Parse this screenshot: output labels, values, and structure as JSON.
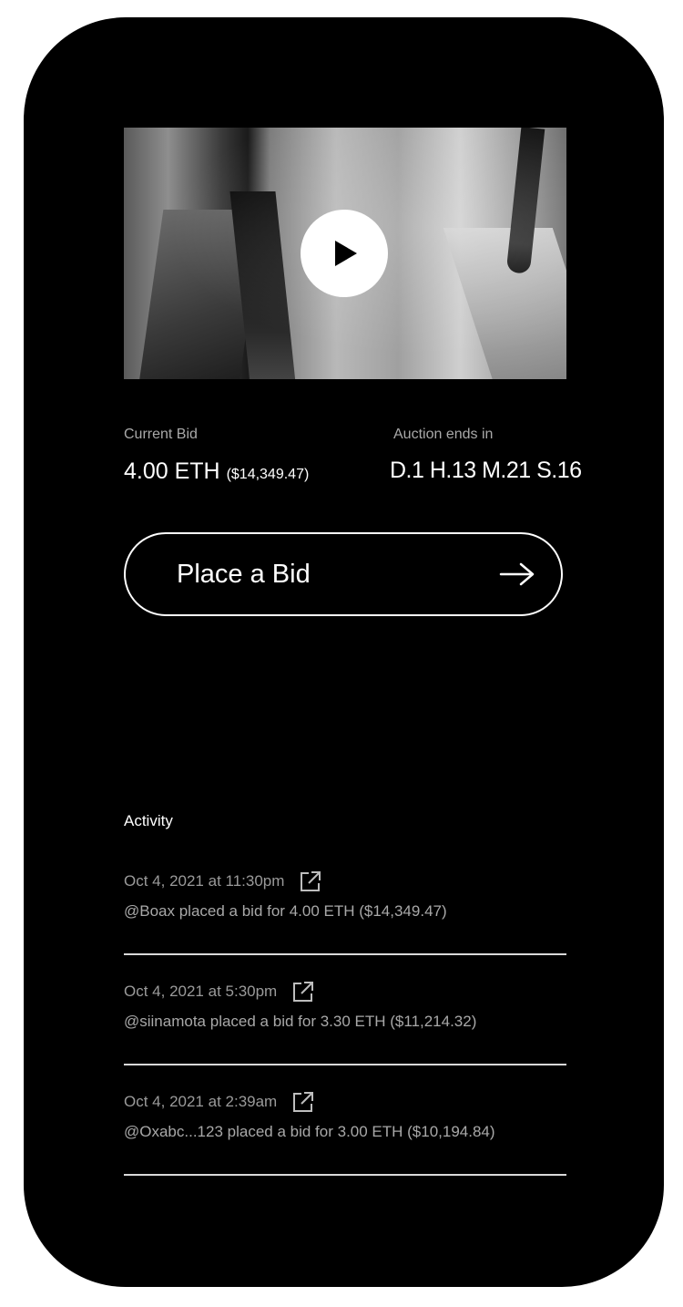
{
  "media": {
    "play_icon": "play-icon"
  },
  "current_bid": {
    "label": "Current Bid",
    "amount": "4.00 ETH",
    "usd": "($14,349.47)"
  },
  "auction": {
    "label": "Auction ends in",
    "countdown": "D.1 H.13 M.21 S.16"
  },
  "bid_button": {
    "label": "Place a Bid",
    "icon": "arrow-right-icon"
  },
  "activity": {
    "title": "Activity",
    "items": [
      {
        "date": "Oct 4, 2021 at 11:30pm",
        "description": "@Boax placed a bid for 4.00 ETH ($14,349.47)"
      },
      {
        "date": "Oct 4, 2021 at 5:30pm",
        "description": "@siinamota placed a bid for 3.30 ETH ($11,214.32)"
      },
      {
        "date": "Oct 4, 2021 at 2:39am",
        "description": "@Oxabc...123 placed a bid for 3.00 ETH ($10,194.84)"
      }
    ]
  },
  "colors": {
    "background": "#000000",
    "text_primary": "#ffffff",
    "text_secondary": "#a9a9a9"
  }
}
